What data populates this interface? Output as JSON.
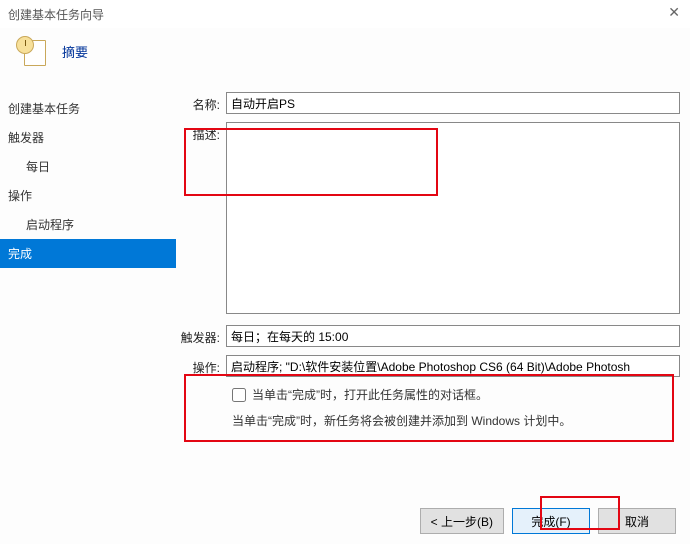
{
  "window": {
    "title": "创建基本任务向导",
    "close_glyph": "✕"
  },
  "header": {
    "title": "摘要"
  },
  "sidebar": {
    "items": [
      {
        "label": "创建基本任务",
        "sub": false,
        "selected": false
      },
      {
        "label": "触发器",
        "sub": false,
        "selected": false
      },
      {
        "label": "每日",
        "sub": true,
        "selected": false
      },
      {
        "label": "操作",
        "sub": false,
        "selected": false
      },
      {
        "label": "启动程序",
        "sub": true,
        "selected": false
      },
      {
        "label": "完成",
        "sub": false,
        "selected": true
      }
    ]
  },
  "form": {
    "name_label": "名称:",
    "name_value": "自动开启PS",
    "desc_label": "描述:",
    "desc_value": "",
    "trigger_label": "触发器:",
    "trigger_value": "每日；在每天的 15:00",
    "action_label": "操作:",
    "action_value": "启动程序; \"D:\\软件安装位置\\Adobe Photoshop CS6 (64 Bit)\\Adobe Photosh"
  },
  "notes": {
    "checkbox_label": "当单击“完成”时，打开此任务属性的对话框。",
    "info_text": "当单击“完成”时，新任务将会被创建并添加到 Windows 计划中。"
  },
  "footer": {
    "back_label": "< 上一步(B)",
    "finish_label": "完成(F)",
    "cancel_label": "取消"
  }
}
